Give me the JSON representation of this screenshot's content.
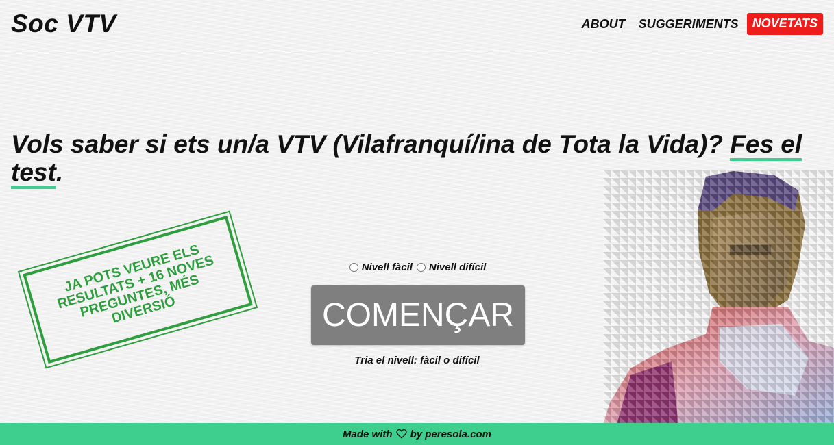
{
  "header": {
    "logo": "Soc VTV",
    "nav": {
      "about": "ABOUT",
      "suggestions": "SUGGERIMENTS",
      "news": "NOVETATS"
    }
  },
  "main": {
    "headline_text": "Vols saber si ets un/a VTV (Vilafranquí/ina de Tota la Vida)? ",
    "headline_link": "Fes el test",
    "headline_end": ".",
    "stamp": "Ja pots veure els resultats + 16 noves preguntes, més diversió",
    "level_easy": "Nivell fàcil",
    "level_hard": "Nivell difícil",
    "start_button": "COMENÇAR",
    "hint": "Tria el nivell: fàcil o difícil"
  },
  "footer": {
    "prefix": "Made with",
    "suffix": "by peresola.com"
  },
  "colors": {
    "accent_green": "#3ecf8e",
    "stamp_green": "#2e9e3e",
    "news_red": "#ef1c1c",
    "button_gray": "#7f7f7f"
  }
}
